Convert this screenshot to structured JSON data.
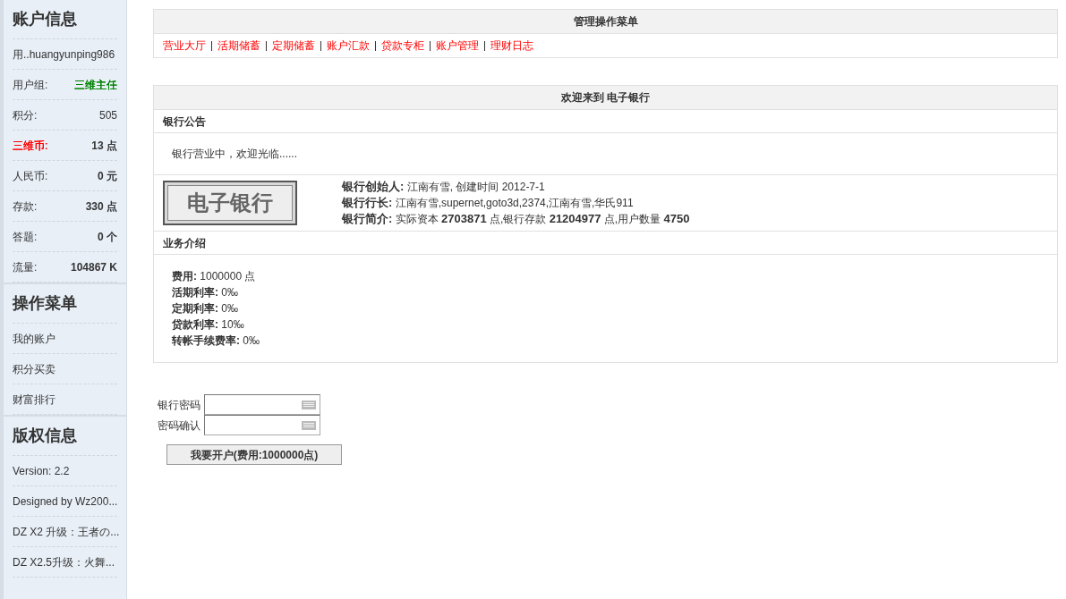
{
  "sidebar": {
    "sections": [
      {
        "title": "账户信息",
        "rows": [
          {
            "kind": "text",
            "text": "用..huangyunping986"
          },
          {
            "kind": "pair",
            "label": {
              "text": "用户组:"
            },
            "value": {
              "text": "三维主任",
              "color": "#008000"
            },
            "bold": false
          },
          {
            "kind": "pair",
            "label": {
              "text": "积分:"
            },
            "value": {
              "text": "505"
            },
            "bold": false
          },
          {
            "kind": "pair",
            "label": {
              "text": "三维币:",
              "color": "#ff0000"
            },
            "value": {
              "text": "13 点"
            },
            "bold": true
          },
          {
            "kind": "pair",
            "label": {
              "text": "人民币:"
            },
            "value": {
              "text": "0 元"
            },
            "bold": true
          },
          {
            "kind": "pair",
            "label": {
              "text": "存款:"
            },
            "value": {
              "text": "330 点"
            },
            "bold": true
          },
          {
            "kind": "pair",
            "label": {
              "text": "答题:"
            },
            "value": {
              "text": "0 个"
            },
            "bold": true
          },
          {
            "kind": "pair",
            "label": {
              "text": "流量:"
            },
            "value": {
              "text": "104867 K"
            },
            "bold": true
          }
        ]
      },
      {
        "title": "操作菜单",
        "rows": [
          {
            "kind": "link",
            "text": "我的账户"
          },
          {
            "kind": "link",
            "text": "积分买卖"
          },
          {
            "kind": "link",
            "text": "财富排行"
          }
        ]
      },
      {
        "title": "版权信息",
        "rows": [
          {
            "kind": "text",
            "text": "Version: 2.2"
          },
          {
            "kind": "text",
            "text": "Designed by Wz200..."
          },
          {
            "kind": "text",
            "text": "DZ X2 升级：王者の..."
          },
          {
            "kind": "text",
            "text": "DZ X2.5升级：火舞..."
          }
        ]
      }
    ]
  },
  "menu_panel": {
    "title": "管理操作菜单",
    "links": [
      "营业大厅",
      "活期储蓄",
      "定期储蓄",
      "账户汇款",
      "贷款专柜",
      "账户管理",
      "理财日志"
    ]
  },
  "bank_panel": {
    "title": "欢迎来到 电子银行",
    "notice_heading": "银行公告",
    "notice": "银行营业中，欢迎光临......",
    "logo_text": "电子银行",
    "info": [
      "**银行创始人:** 江南有雪, 创建时间 2012-7-1",
      "**银行行长:** 江南有雪,supernet,goto3d,2374,江南有雪,华氏911",
      "**银行简介:** 实际资本 **2703871** 点,银行存款 **21204977** 点,用户数量 **4750**"
    ],
    "services_heading": "业务介绍",
    "services": [
      "**费用:** 1000000 点",
      "**活期利率:** 0‰",
      "**定期利率:** 0‰",
      "**贷款利率:** 10‰",
      "**转帐手续费率:** 0‰"
    ]
  },
  "form": {
    "fields": [
      {
        "label": "银行密码"
      },
      {
        "label": "密码确认"
      }
    ],
    "submit": "我要开户(费用:1000000点)"
  }
}
